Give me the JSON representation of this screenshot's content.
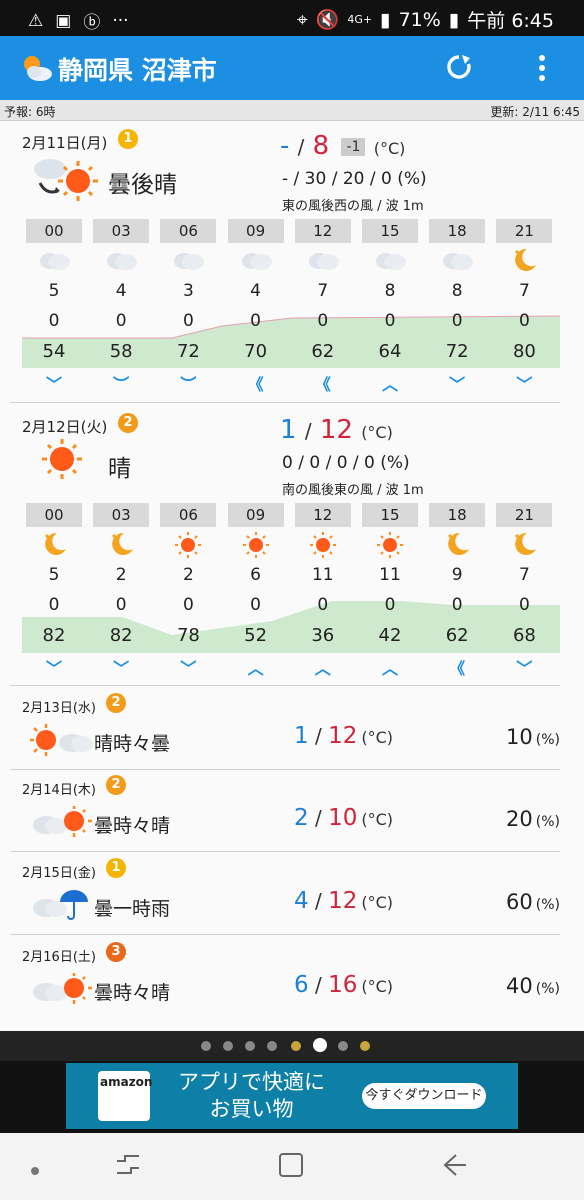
{
  "status": {
    "battery": "71%",
    "time": "午前 6:45",
    "net": "4G+"
  },
  "app": {
    "title": "静岡県 沼津市"
  },
  "subbar": {
    "left": "予報: 6時",
    "right": "更新: 2/11 6:45"
  },
  "colors": {
    "accent": "#1c8fe3",
    "low": "#1c7fd8",
    "high": "#d0243a",
    "green": "#cfe9cf"
  },
  "day1": {
    "date": "2月11日(月)",
    "rank": "1",
    "weather": "曇後晴",
    "low": "-",
    "sep": "/",
    "high": "8",
    "diff": "-1",
    "unit": "(°C)",
    "pop": "- / 30 / 20 / 0 (%)",
    "wind": "東の風後西の風 / 波 1m",
    "hours": [
      "00",
      "03",
      "06",
      "09",
      "12",
      "15",
      "18",
      "21"
    ],
    "icons": [
      "cloud-icon",
      "cloud-icon",
      "cloud-icon",
      "cloud-icon",
      "cloud-icon",
      "cloud-icon",
      "cloud-icon",
      "moon-icon"
    ],
    "temps": [
      "5",
      "4",
      "3",
      "4",
      "7",
      "8",
      "8",
      "7"
    ],
    "rain": [
      "0",
      "0",
      "0",
      "0",
      "0",
      "0",
      "0",
      "0"
    ],
    "humidity": [
      "54",
      "58",
      "72",
      "70",
      "62",
      "64",
      "72",
      "80"
    ],
    "winds": [
      "﹀",
      "︶",
      "︶",
      "《",
      "《",
      "︿",
      "﹀",
      "﹀"
    ]
  },
  "day2": {
    "date": "2月12日(火)",
    "rank": "2",
    "weather": "晴",
    "low": "1",
    "sep": "/",
    "high": "12",
    "unit": "(°C)",
    "pop": "0 / 0 / 0 / 0 (%)",
    "wind": "南の風後東の風 / 波 1m",
    "hours": [
      "00",
      "03",
      "06",
      "09",
      "12",
      "15",
      "18",
      "21"
    ],
    "icons": [
      "moon-icon",
      "moon-icon",
      "sun-icon",
      "sun-icon",
      "sun-icon",
      "sun-icon",
      "moon-icon",
      "moon-icon"
    ],
    "temps": [
      "5",
      "2",
      "2",
      "6",
      "11",
      "11",
      "9",
      "7"
    ],
    "rain": [
      "0",
      "0",
      "0",
      "0",
      "0",
      "0",
      "0",
      "0"
    ],
    "humidity": [
      "82",
      "82",
      "78",
      "52",
      "36",
      "42",
      "62",
      "68"
    ],
    "winds": [
      "﹀",
      "﹀",
      "﹀",
      "︿",
      "︿",
      "︿",
      "《",
      "﹀"
    ]
  },
  "days": [
    {
      "date": "2月13日(水)",
      "rank": "2",
      "weather": "晴時々曇",
      "low": "1",
      "high": "12",
      "unit": "(°C)",
      "pop": "10",
      "pop_unit": "(%)"
    },
    {
      "date": "2月14日(木)",
      "rank": "2",
      "weather": "曇時々晴",
      "low": "2",
      "high": "10",
      "unit": "(°C)",
      "pop": "20",
      "pop_unit": "(%)"
    },
    {
      "date": "2月15日(金)",
      "rank": "1",
      "weather": "曇一時雨",
      "low": "4",
      "high": "12",
      "unit": "(°C)",
      "pop": "60",
      "pop_unit": "(%)"
    },
    {
      "date": "2月16日(土)",
      "rank": "3",
      "weather": "曇時々晴",
      "low": "6",
      "high": "16",
      "unit": "(°C)",
      "pop": "40",
      "pop_unit": "(%)"
    }
  ],
  "ad": {
    "line1": "アプリで快適に",
    "line2": "お買い物",
    "button": "今すぐダウンロード",
    "brand": "amazon"
  }
}
